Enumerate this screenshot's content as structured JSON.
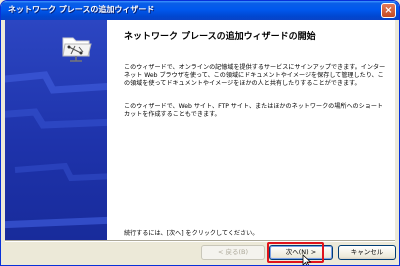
{
  "window": {
    "title": "ネットワーク プレースの追加ウィザード",
    "close_glyph": "×"
  },
  "main": {
    "heading": "ネットワーク プレースの追加ウィザードの開始",
    "paragraph1": "このウィザードで、オンラインの記憶域を提供するサービスにサインアップできます。インターネット Web ブラウザを使って、この領域にドキュメントやイメージを保存して管理したり、この領域を使ってドキュメントやイメージをほかの人と共有したりすることができます。",
    "paragraph2": "このウィザードで、Web サイト、FTP サイト、またはほかのネットワークの場所へのショートカットを作成することもできます。",
    "continue_text": "続行するには、[次へ] をクリックしてください。"
  },
  "buttons": {
    "back": "< 戻る(B)",
    "next": "次へ(N) >",
    "cancel": "キャンセル"
  },
  "icons": {
    "wizard_icon": "network-folder-icon",
    "cursor": "mouse-pointer-icon"
  },
  "colors": {
    "titlebar": "#0058ee",
    "left_panel": "#1e33ab",
    "highlight": "#e0141c"
  }
}
